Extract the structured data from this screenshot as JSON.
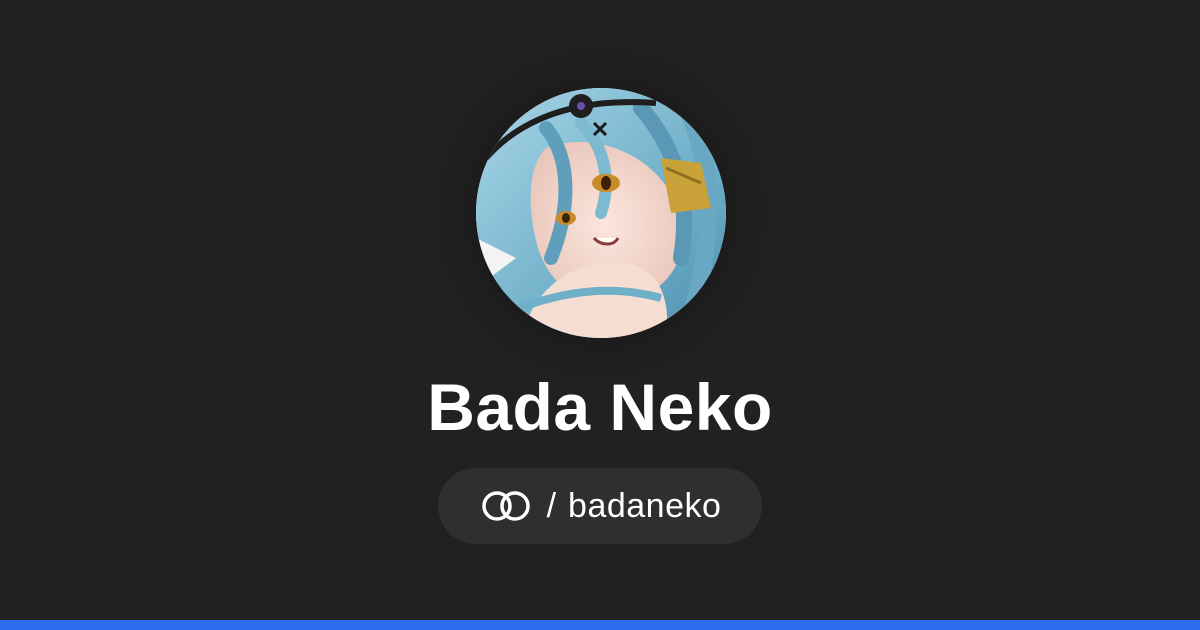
{
  "profile": {
    "name": "Bada Neko",
    "handle_separator": "/",
    "handle": "badaneko",
    "avatar_icon": "avatar-illustration",
    "logo_icon": "linked-rings-icon"
  },
  "colors": {
    "background": "#212121",
    "pill": "#2f2f2f",
    "text": "#ffffff",
    "accent_bar": "#2f6bed"
  }
}
